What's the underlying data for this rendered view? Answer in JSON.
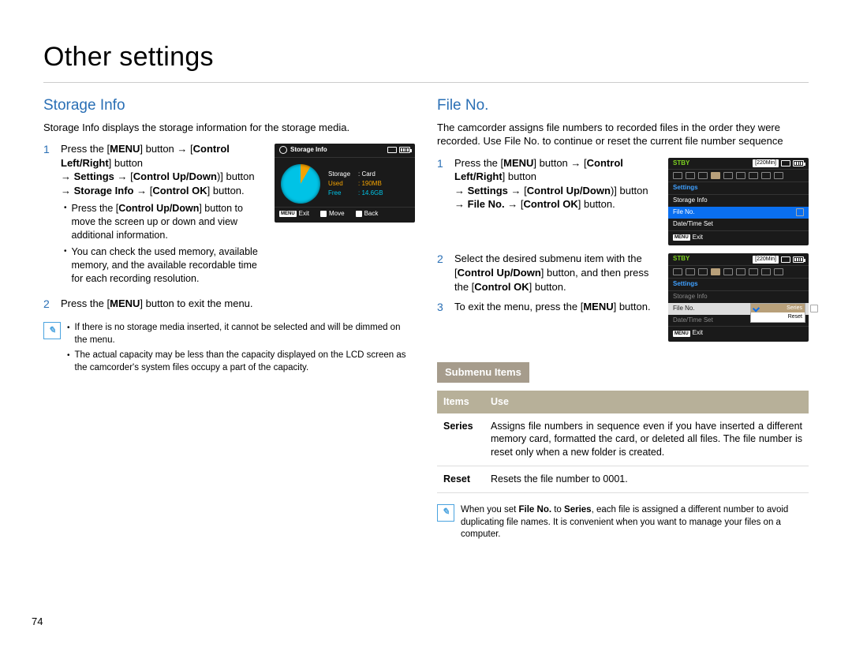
{
  "page_title": "Other settings",
  "page_number": "74",
  "arrow": "→",
  "left": {
    "heading": "Storage Info",
    "intro": "Storage Info displays the storage information for the storage media.",
    "step1": {
      "num": "1",
      "pre": "Press the [",
      "menu": "MENU",
      "a1": "] button ",
      "a2": " [",
      "ctrl_lr": "Control Left/Right",
      "a3": "] button ",
      "a4": " ",
      "settings": "Settings",
      "a5": " ",
      "a6": " [",
      "ctrl_ud": "Control Up/Down",
      "a7": ")] button ",
      "a8": " ",
      "storage": "Storage Info",
      "a9": " ",
      "a10": " [",
      "ctrl_ok": "Control OK",
      "a11": "] button."
    },
    "sub1": {
      "pre": "Press the [",
      "ctrl_ud": "Control Up/Down",
      "post": "] button to move the screen up or down and view additional information."
    },
    "sub2": "You can check the used memory, available memory, and the available recordable time for each recording resolution.",
    "step2": {
      "num": "2",
      "pre": "Press the [",
      "menu": "MENU",
      "post": "] button to exit the menu."
    },
    "note1": "If there is no storage media inserted, it cannot be selected and will be dimmed on the menu.",
    "note2": "The actual capacity may be less than the capacity displayed on the LCD screen as the camcorder's system files occupy a part of the capacity.",
    "lcd": {
      "title": "Storage Info",
      "storage_label": "Storage",
      "storage_val": ": Card",
      "used_label": "Used",
      "used_val": ": 190MB",
      "free_label": "Free",
      "free_val": ": 14.6GB",
      "footer_exit": "Exit",
      "footer_move": "Move",
      "footer_back": "Back"
    }
  },
  "right": {
    "heading": "File No.",
    "intro": "The camcorder assigns file numbers to recorded files in the order they were recorded. Use File No. to continue or reset the current file number sequence",
    "step1": {
      "num": "1",
      "pre": "Press the [",
      "menu": "MENU",
      "a1": "] button ",
      "a2": " [",
      "ctrl_lr": "Control Left/Right",
      "a3": "] button ",
      "a4": " ",
      "settings": "Settings",
      "a5": " ",
      "a6": " [",
      "ctrl_ud": "Control Up/Down",
      "a7": ")] button ",
      "a8": " ",
      "fileno": "File No.",
      "a9": " ",
      "a10": " [",
      "ctrl_ok": "Control OK",
      "a11": "] button."
    },
    "step2": {
      "num": "2",
      "pre": "Select the desired submenu item with the [",
      "ctrl_ud": "Control Up/Down",
      "mid": "] button, and then press the [",
      "ctrl_ok": "Control OK",
      "post": "] button."
    },
    "step3": {
      "num": "3",
      "pre": "To exit the menu, press the [",
      "menu": "MENU",
      "post": "] button."
    },
    "lcd1": {
      "stby": "STBY",
      "time": "[220Min]",
      "menu_header": "Settings",
      "item1": "Storage Info",
      "item_sel": "File No.",
      "item2": "Date/Time Set",
      "exit": "Exit"
    },
    "lcd2": {
      "stby": "STBY",
      "time": "[220Min]",
      "menu_header": "Settings",
      "item1": "Storage Info",
      "item_sel": "File No.",
      "item2": "Date/Time Set",
      "fly1": "Series",
      "fly2": "Reset",
      "exit": "Exit"
    },
    "submenu_title": "Submenu Items",
    "table": {
      "h1": "Items",
      "h2": "Use",
      "r1name": "Series",
      "r1use": "Assigns file numbers in sequence even if you have inserted a different memory card, formatted the card, or deleted all files. The file number is reset only when a new folder is created.",
      "r2name": "Reset",
      "r2use": "Resets the file number to 0001."
    },
    "note": {
      "pre": "When you set ",
      "fileno": "File No.",
      "mid": " to ",
      "series": "Series",
      "post": ", each file is assigned a different number to avoid duplicating file names. It is convenient when you want to manage your files on a computer."
    }
  },
  "chart_data": {
    "type": "pie",
    "title": "Storage Info",
    "categories": [
      "Used",
      "Free"
    ],
    "values": [
      190,
      14950
    ],
    "units": "MB",
    "raw_labels": {
      "Used": "190MB",
      "Free": "14.6GB"
    },
    "storage": "Card"
  }
}
